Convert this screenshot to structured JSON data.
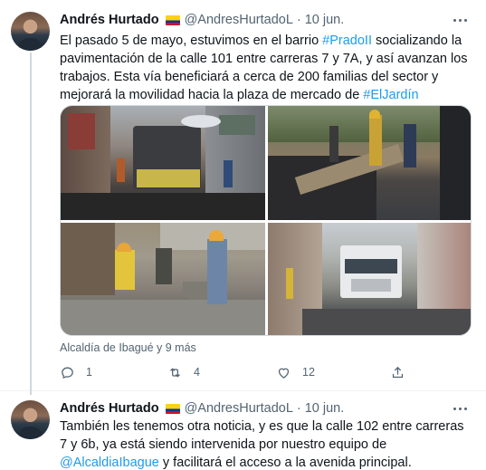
{
  "tweets": [
    {
      "author": "Andrés Hurtado",
      "handle": "@AndresHurtadoL",
      "separator": "·",
      "date": "10 jun.",
      "text_parts": [
        "El pasado 5 de mayo, estuvimos en el barrio ",
        "#PradoII",
        " socializando la pavimentación de la calle 101 entre carreras 7 y 7A, y así avanzan los trabajos. Esta vía beneficiará a cerca de 200 familias del sector y mejorará la movilidad hacia la plaza de mercado de ",
        "#ElJardín"
      ],
      "tagged": "Alcaldía de Ibagué y 9 más",
      "replies": "1",
      "retweets": "4",
      "likes": "12"
    },
    {
      "author": "Andrés Hurtado",
      "handle": "@AndresHurtadoL",
      "separator": "·",
      "date": "10 jun.",
      "text_parts": [
        "También les tenemos otra noticia, y es que la calle 102 entre carreras 7 y 6b, ya está siendo intervenida por nuestro equipo de ",
        "@AlcaldiaIbague",
        " y facilitará el acceso a la avenida principal."
      ]
    }
  ],
  "colors": {
    "link": "#1d9bf0",
    "secondary_text": "#536471",
    "primary_text": "#0f1419"
  },
  "icons": [
    "more-icon",
    "reply-icon",
    "retweet-icon",
    "like-icon",
    "share-icon",
    "colombia-flag-icon"
  ]
}
